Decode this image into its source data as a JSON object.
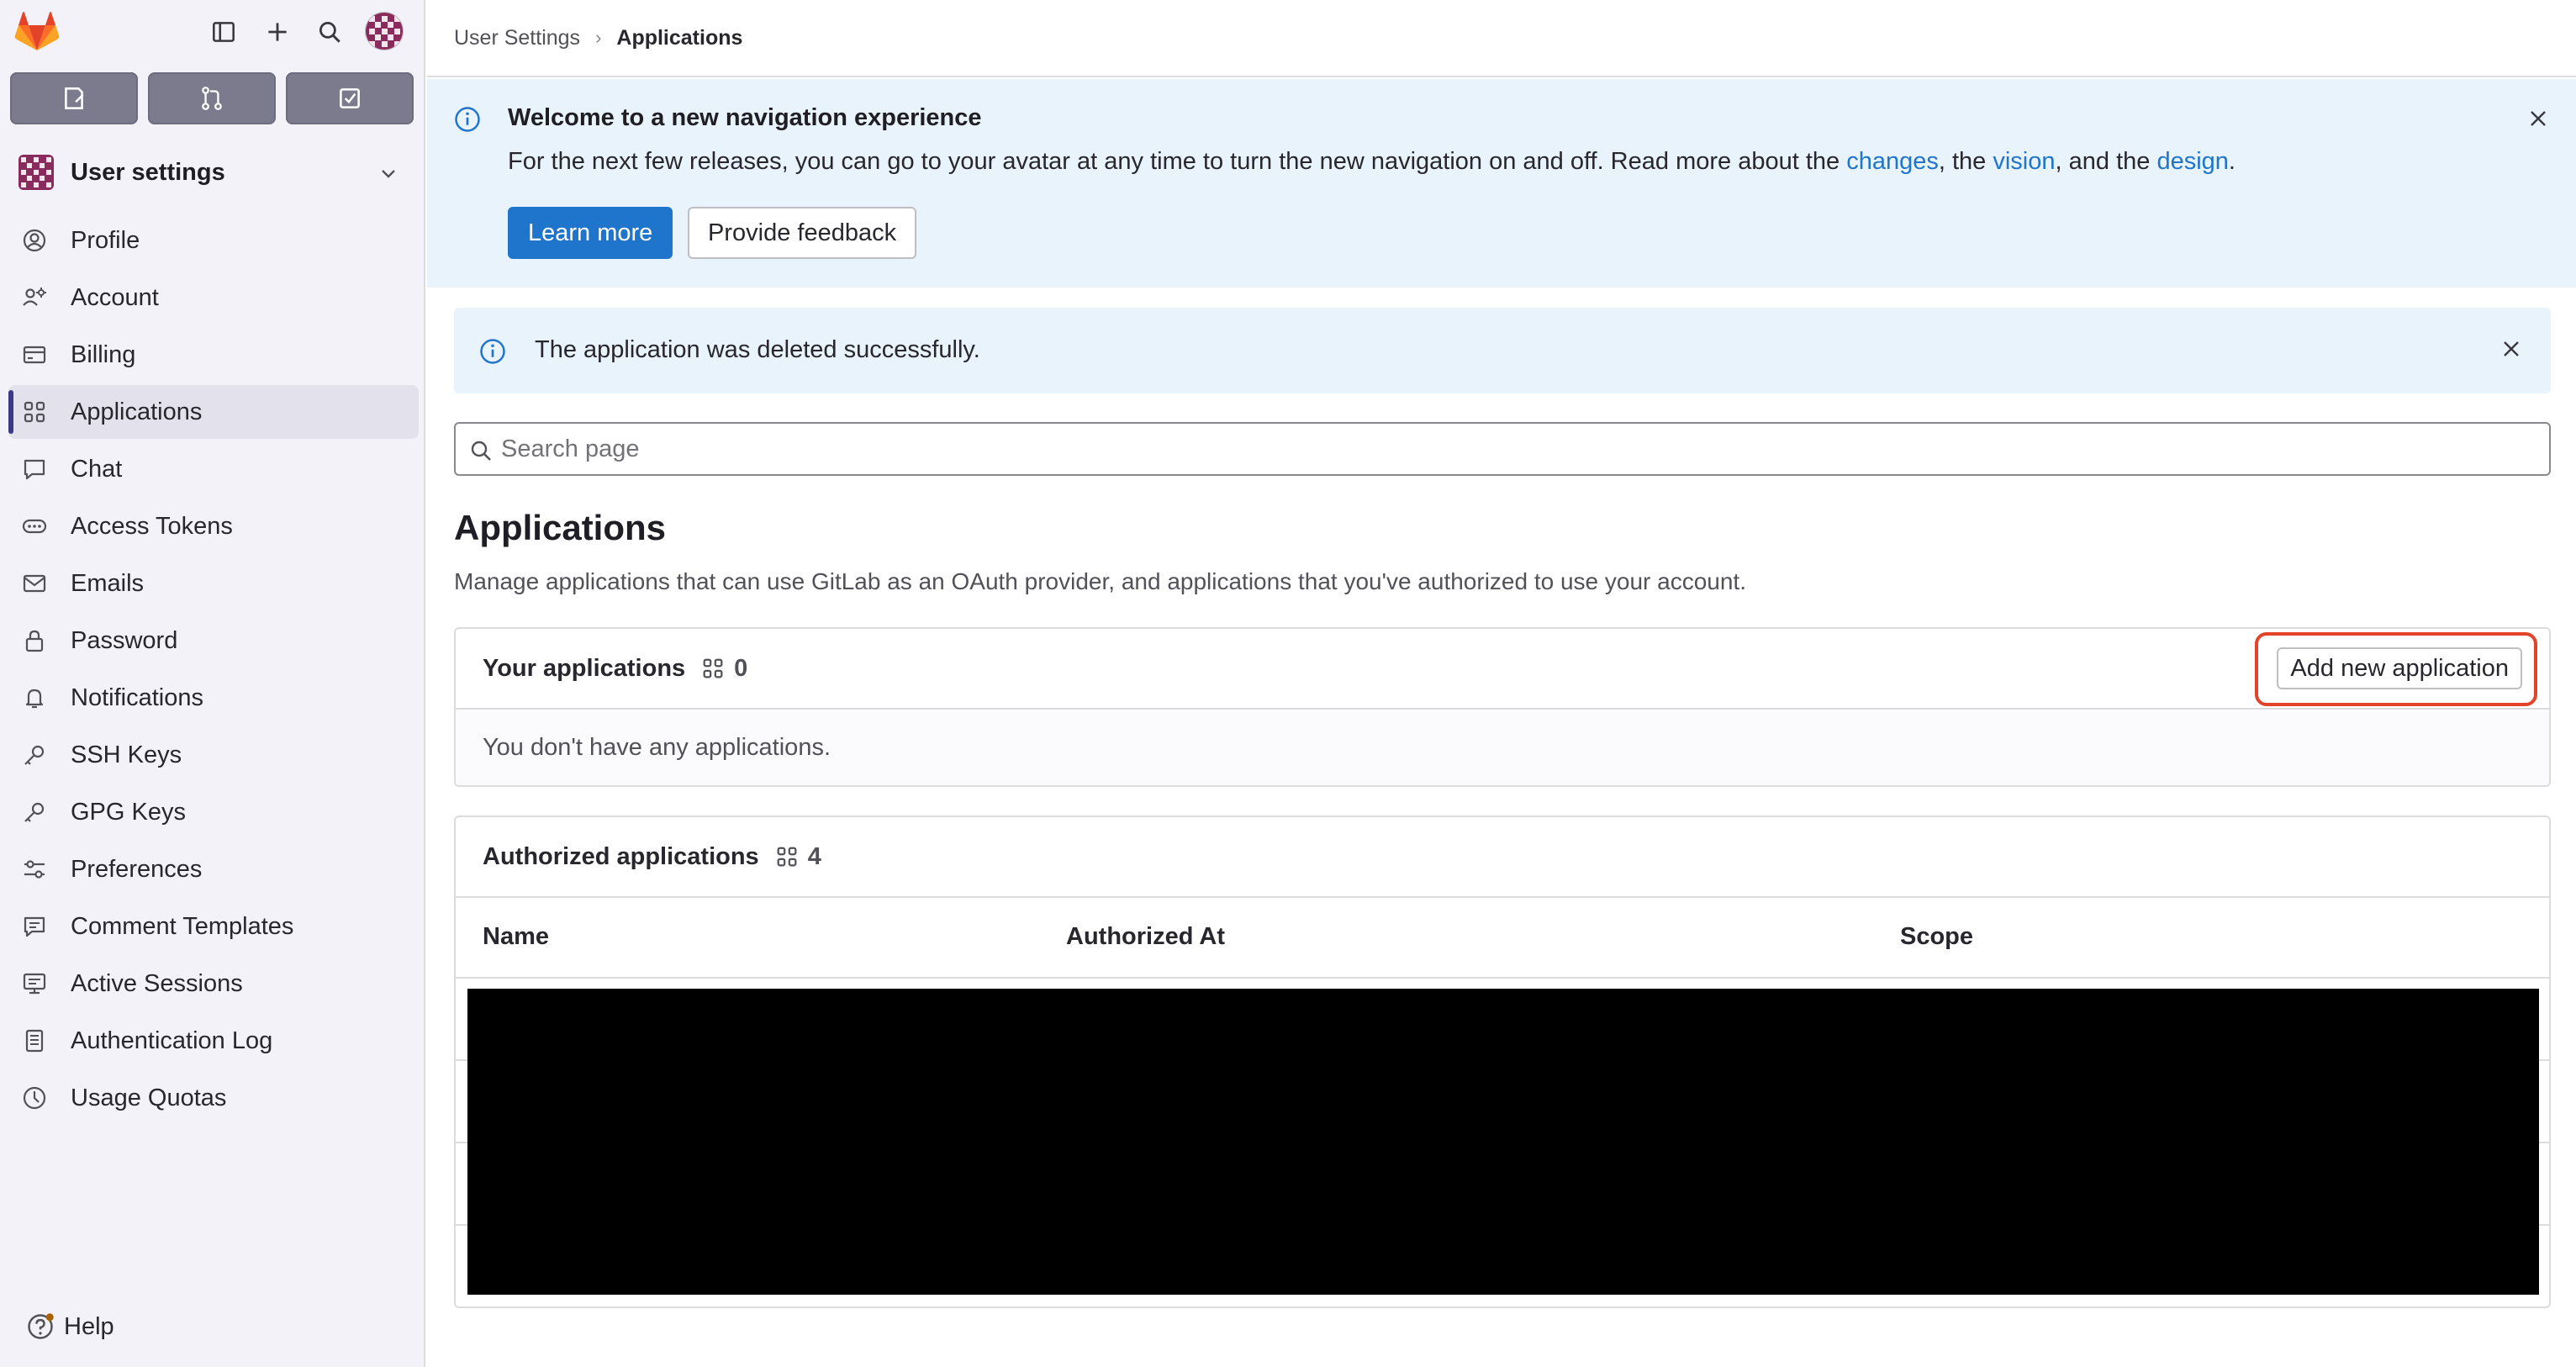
{
  "sidebar": {
    "context_title": "User settings",
    "items": [
      {
        "label": "Profile",
        "icon": "user-icon"
      },
      {
        "label": "Account",
        "icon": "account-icon"
      },
      {
        "label": "Billing",
        "icon": "credit-card-icon"
      },
      {
        "label": "Applications",
        "icon": "applications-icon",
        "active": true
      },
      {
        "label": "Chat",
        "icon": "comment-icon"
      },
      {
        "label": "Access Tokens",
        "icon": "token-icon"
      },
      {
        "label": "Emails",
        "icon": "mail-icon"
      },
      {
        "label": "Password",
        "icon": "lock-icon"
      },
      {
        "label": "Notifications",
        "icon": "notifications-icon"
      },
      {
        "label": "SSH Keys",
        "icon": "key-icon"
      },
      {
        "label": "GPG Keys",
        "icon": "key-icon"
      },
      {
        "label": "Preferences",
        "icon": "preferences-icon"
      },
      {
        "label": "Comment Templates",
        "icon": "comment-lines-icon"
      },
      {
        "label": "Active Sessions",
        "icon": "monitor-icon"
      },
      {
        "label": "Authentication Log",
        "icon": "log-icon"
      },
      {
        "label": "Usage Quotas",
        "icon": "quota-icon"
      }
    ],
    "help_label": "Help"
  },
  "breadcrumb": {
    "parent": "User Settings",
    "current": "Applications"
  },
  "welcome": {
    "title": "Welcome to a new navigation experience",
    "text_before": "For the next few releases, you can go to your avatar at any time to turn the new navigation on and off. Read more about the ",
    "link_changes": "changes",
    "sep1": ", the ",
    "link_vision": "vision",
    "sep2": ", and the ",
    "link_design": "design",
    "text_after": ".",
    "learn_more": "Learn more",
    "feedback": "Provide feedback"
  },
  "alert": {
    "text": "The application was deleted successfully."
  },
  "search": {
    "placeholder": "Search page"
  },
  "page": {
    "title": "Applications",
    "description": "Manage applications that can use GitLab as an OAuth provider, and applications that you've authorized to use your account."
  },
  "your_apps": {
    "title": "Your applications",
    "count": "0",
    "empty": "You don't have any applications.",
    "add_button": "Add new application"
  },
  "authorized_apps": {
    "title": "Authorized applications",
    "count": "4",
    "columns": [
      "Name",
      "Authorized At",
      "Scope"
    ]
  },
  "colors": {
    "accent": "#1f75cb",
    "highlight": "#e24329",
    "sidebar_bg": "#f3f2f8",
    "info_bg": "#e9f3fc"
  }
}
